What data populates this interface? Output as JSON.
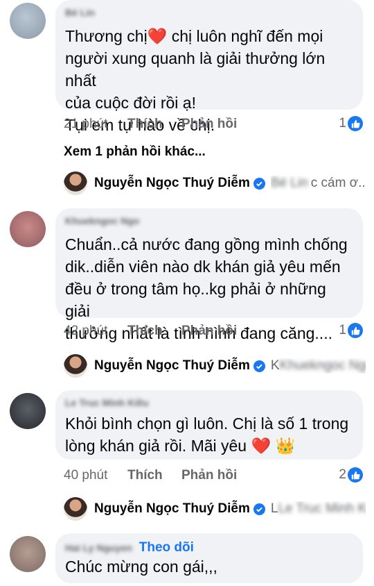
{
  "comments": [
    {
      "author": "Bé Lin",
      "text": "Thương chị❤️ chị luôn nghĩ đến mọi\nngười xung quanh là giải thưởng lớn nhất\ncủa cuộc đời rồi ạ!\nTụi em tự hào về chị.",
      "time": "21 phút",
      "like_label": "Thích",
      "reply_label": "Phản hồi",
      "reaction_count": "1",
      "more_replies": "Xem 1 phản hồi khác...",
      "reply": {
        "author": "Nguyễn Ngọc Thuý Diễm",
        "snippet_blur": "Bé Lin",
        "snippet": "c cám ơ..."
      }
    },
    {
      "author": "Khuekngoc Ngo",
      "text": "Chuẩn..cả nước đang gồng mình chống\ndik..diễn viên nào dk khán giả yêu mến\nđều ở trong tâm họ..kg phải ở những giải\nthưởng nhất là tình hình đang căng....",
      "time": "42 phút",
      "like_label": "Thích",
      "reply_label": "Phản hồi",
      "reaction_count": "1",
      "reply": {
        "author": "Nguyễn Ngọc Thuý Diễm",
        "snippet": "K",
        "snippet_blur": "Khuekngoc Ngo"
      }
    },
    {
      "author": "Le Truc Minh Kiều",
      "text": "Khỏi bình chọn gì luôn. Chị là số 1 trong\nlòng khán giả rồi. Mãi yêu ❤️ 👑",
      "time": "40 phút",
      "like_label": "Thích",
      "reply_label": "Phản hồi",
      "reaction_count": "2",
      "reply": {
        "author": "Nguyễn Ngọc Thuý Diễm",
        "snippet": "L",
        "snippet_blur": "Le Truc Minh Kiều"
      }
    },
    {
      "author": "Hai Ly Nguyen",
      "follow_label": "Theo dõi",
      "text": "Chúc mừng con gái,,,"
    }
  ],
  "colors": {
    "bubble": "#f0f2f5",
    "meta": "#65676b",
    "accent": "#1877f2"
  }
}
